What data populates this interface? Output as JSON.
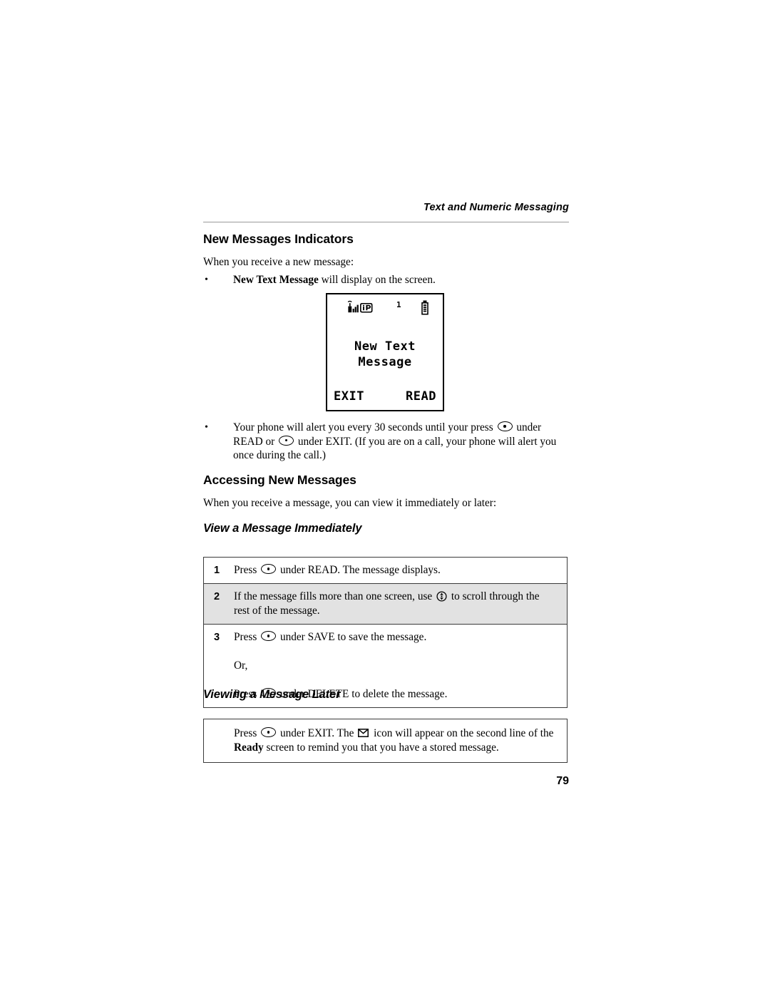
{
  "header": {
    "running_title": "Text and Numeric Messaging"
  },
  "sections": {
    "new_messages_indicators": {
      "heading": "New Messages Indicators",
      "intro": "When you receive a new message:",
      "bullet1_bold": "New Text Message",
      "bullet1_rest": " will display on the screen.",
      "bullet2_part1": "Your phone will alert you every 30 seconds until your press ",
      "bullet2_part2": " under READ or ",
      "bullet2_part3": " under EXIT. (If you are on a call, your phone will alert you once during the call.)"
    },
    "accessing_new_messages": {
      "heading": "Accessing New Messages",
      "intro": "When you receive a message, you can view it immediately or later:"
    },
    "view_immediately": {
      "heading": "View a Message Immediately",
      "steps": [
        {
          "number": "1",
          "shaded": false,
          "lines": [
            {
              "pre": "Press ",
              "icon": "key-oval",
              "post": " under READ. The message displays."
            }
          ]
        },
        {
          "number": "2",
          "shaded": true,
          "lines": [
            {
              "pre": "If the message fills more than one screen, use ",
              "icon": "nav-key",
              "post": " to scroll through the rest of the message."
            }
          ]
        },
        {
          "number": "3",
          "shaded": false,
          "lines": [
            {
              "pre": "Press ",
              "icon": "key-oval",
              "post": " under SAVE to save the message."
            },
            {
              "pre": "Or,",
              "icon": "",
              "post": ""
            },
            {
              "pre": "Press ",
              "icon": "key-oval",
              "post": " under DELETE to delete the message."
            }
          ]
        }
      ]
    },
    "viewing_later": {
      "heading": "Viewing a Message Later",
      "note_pre": "Press ",
      "note_mid": " under EXIT. The ",
      "note_post_1": " icon will appear on the second line of the ",
      "note_bold": "Ready",
      "note_post_2": " screen to remind you that you have a stored message."
    }
  },
  "phone_screen": {
    "status": {
      "signal_icon": "signal-bars-icon",
      "ip_badge": "iP",
      "message_count": "1",
      "battery_icon": "battery-icon"
    },
    "message_line1": "New Text",
    "message_line2": "Message",
    "softkey_left": "EXIT",
    "softkey_right": "READ"
  },
  "footer": {
    "page_number": "79"
  },
  "colors": {
    "text": "#000000",
    "rule": "#9a9a9a",
    "table_border": "#3a3a3a",
    "shaded_row": "#e2e2e2",
    "background": "#ffffff"
  }
}
